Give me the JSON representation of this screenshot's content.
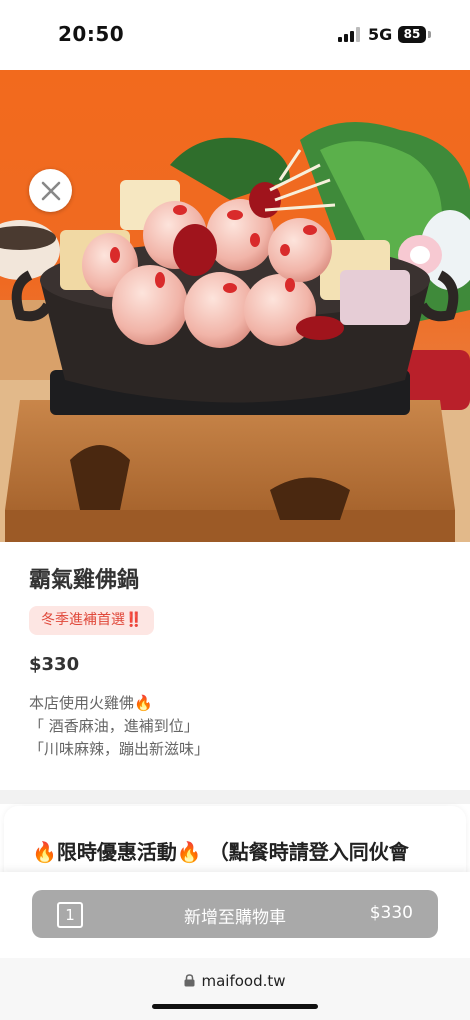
{
  "status_bar": {
    "time": "20:50",
    "network": "5G",
    "battery": "85",
    "icons": [
      "signal-icon",
      "battery-icon"
    ]
  },
  "hero": {
    "close_icon": "close-icon",
    "image_subject": "hot-pot-photo"
  },
  "product": {
    "title": "霸氣雞佛鍋",
    "tag": "冬季進補首選‼️",
    "price": "$330",
    "description": [
      "本店使用火雞佛🔥",
      "「 酒香麻油，進補到位」",
      "「川味麻辣，蹦出新滋味」"
    ]
  },
  "promo": {
    "text": "🔥限時優惠活動🔥 （點餐時請登入同伙會"
  },
  "cart": {
    "quantity": "1",
    "label": "新增至購物車",
    "price": "$330"
  },
  "browser": {
    "url": "maifood.tw",
    "lock_icon": "lock-icon"
  },
  "colors": {
    "tag_bg": "#fde6e3",
    "tag_text": "#e0493b",
    "cart_button": "#a9a9a9",
    "hero_bg": "#f0651e"
  }
}
